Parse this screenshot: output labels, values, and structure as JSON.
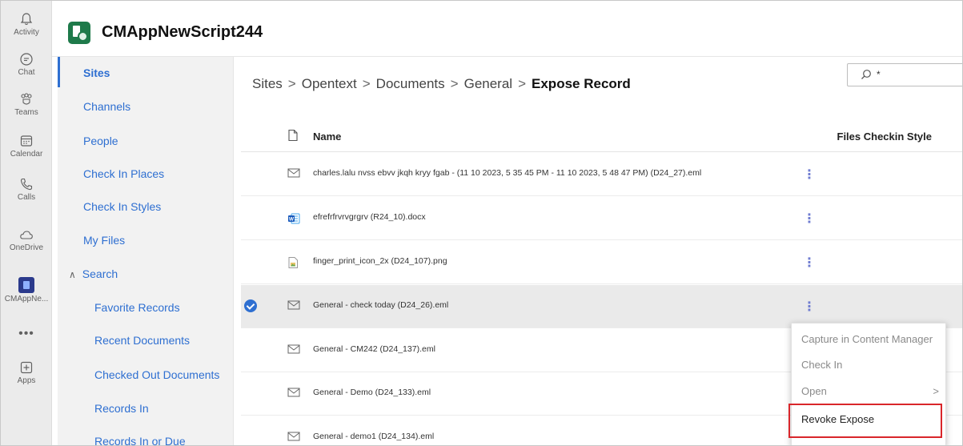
{
  "rail": {
    "items": [
      {
        "label": "Activity",
        "icon": "bell-icon"
      },
      {
        "label": "Chat",
        "icon": "chat-icon"
      },
      {
        "label": "Teams",
        "icon": "teams-icon"
      },
      {
        "label": "Calendar",
        "icon": "calendar-icon"
      },
      {
        "label": "Calls",
        "icon": "phone-icon"
      },
      {
        "label": "OneDrive",
        "icon": "cloud-icon"
      },
      {
        "label": "CMAppNe...",
        "icon": "app-tile-icon"
      },
      {
        "label": "•••",
        "icon": "more-icon"
      },
      {
        "label": "Apps",
        "icon": "add-app-icon"
      }
    ]
  },
  "header": {
    "app_title": "CMAppNewScript244"
  },
  "nav": {
    "items": [
      "Sites",
      "Channels",
      "People",
      "Check In Places",
      "Check In Styles",
      "My Files"
    ],
    "search_label": "Search",
    "search_children": [
      "Favorite Records",
      "Recent Documents",
      "Checked Out Documents",
      "Records In",
      "Records In or Due"
    ]
  },
  "breadcrumb": {
    "items": [
      "Sites",
      "Opentext",
      "Documents",
      "General"
    ],
    "current": "Expose Record",
    "separator": ">"
  },
  "search": {
    "value": "*"
  },
  "table": {
    "col_name": "Name",
    "col_style": "Files Checkin Style",
    "rows": [
      {
        "name": "charles.lalu nvss ebvv jkqh kryy fgab - (11 10 2023, 5 35 45 PM - 11 10 2023, 5 48 47 PM) (D24_27).eml",
        "icon": "mail-icon",
        "selected": false
      },
      {
        "name": "efrefrfrvrvgrgrv (R24_10).docx",
        "icon": "word-icon",
        "selected": false
      },
      {
        "name": "finger_print_icon_2x (D24_107).png",
        "icon": "image-icon",
        "selected": false
      },
      {
        "name": "General - check today (D24_26).eml",
        "icon": "mail-icon",
        "selected": true
      },
      {
        "name": "General - CM242 (D24_137).eml",
        "icon": "mail-icon",
        "selected": false
      },
      {
        "name": "General - Demo (D24_133).eml",
        "icon": "mail-icon",
        "selected": false
      },
      {
        "name": "General - demo1 (D24_134).eml",
        "icon": "mail-icon",
        "selected": false
      }
    ],
    "more_glyph": "⋮"
  },
  "context_menu": {
    "items": [
      "Capture in Content Manager",
      "Check In",
      "Open",
      "Revoke Expose"
    ],
    "open_chevron": ">"
  },
  "colors": {
    "accent": "#2e6fd1",
    "highlight_border": "#d9262b"
  }
}
